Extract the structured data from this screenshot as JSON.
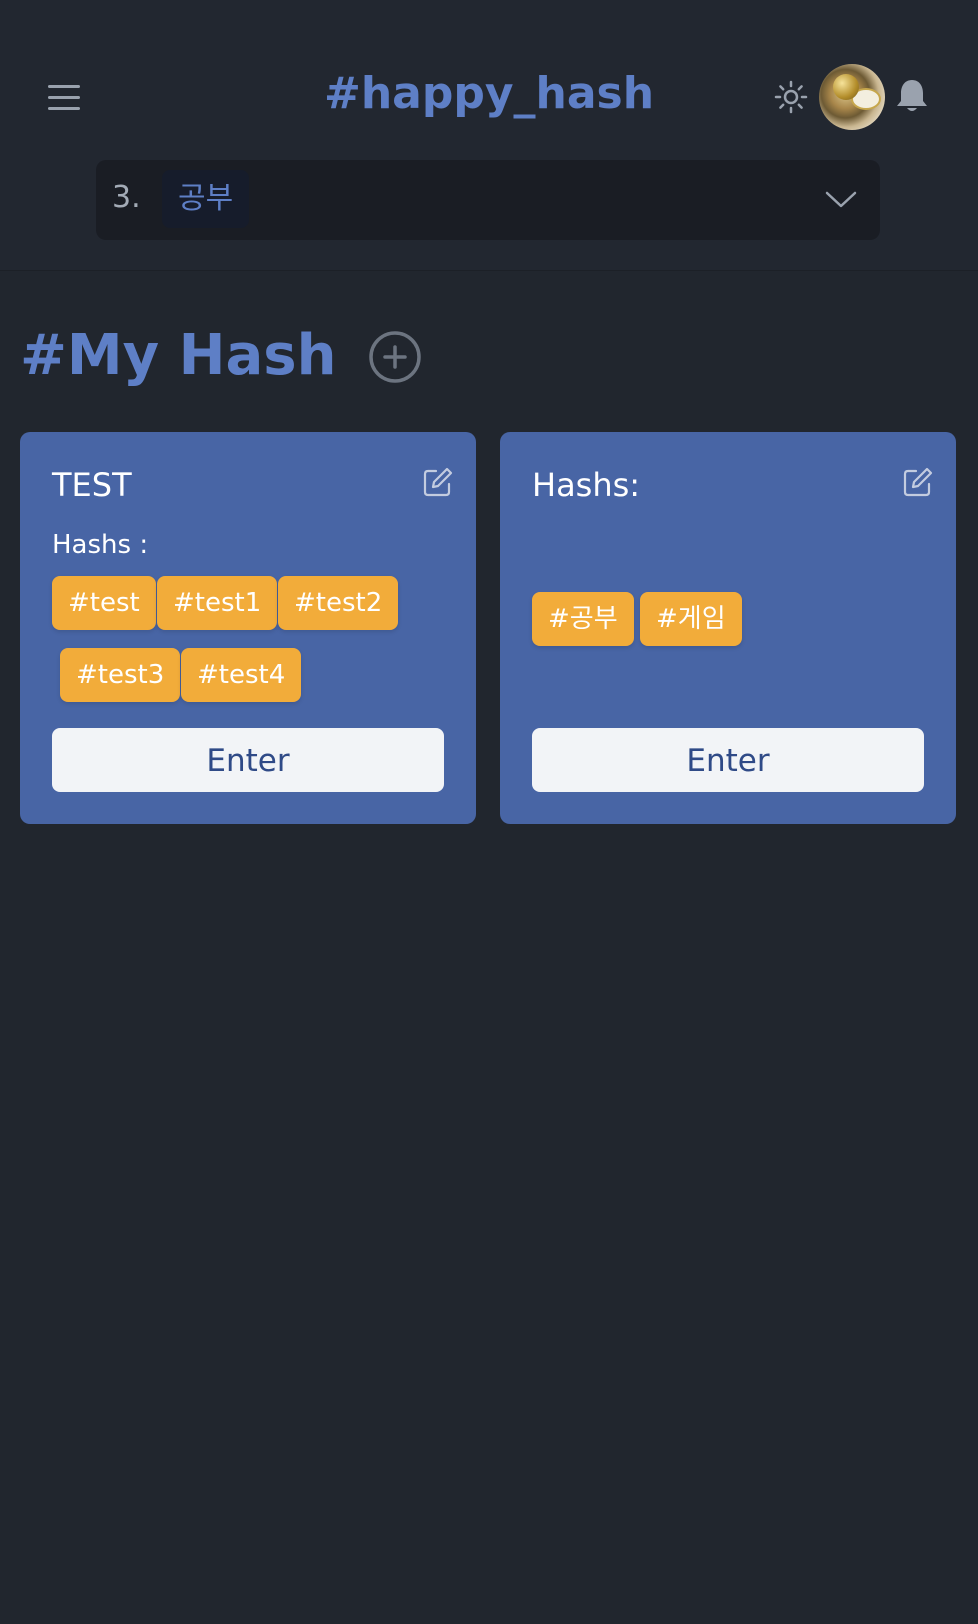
{
  "header": {
    "title": "#happy_hash",
    "menu_icon": "hamburger-menu-icon",
    "theme_icon": "sun-icon",
    "avatar_icon": "profile-avatar",
    "bell_icon": "bell-icon"
  },
  "selector": {
    "index": "3.",
    "selected": "공부",
    "chevron_icon": "chevron-down-icon"
  },
  "main": {
    "section_title": "#My Hash",
    "add_icon": "plus-circle-icon"
  },
  "cards": [
    {
      "title": "TEST",
      "hashs_label": "Hashs :",
      "tags": [
        "#test",
        "#test1",
        "#test2",
        "#test3",
        "#test4"
      ],
      "enter_label": "Enter",
      "edit_icon": "edit-icon"
    },
    {
      "title": "Hashs:",
      "tags": [
        "#공부",
        "#게임"
      ],
      "enter_label": "Enter",
      "edit_icon": "edit-icon"
    }
  ],
  "colors": {
    "background": "#21262e",
    "accent": "#5e7fc6",
    "card": "#4865a5",
    "tag": "#f2ac3a",
    "button_text": "#2f4a87"
  }
}
